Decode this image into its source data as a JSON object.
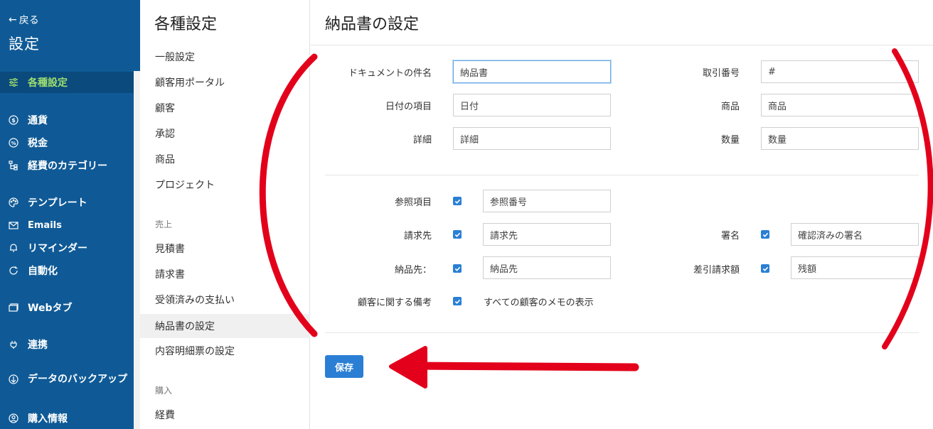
{
  "sidebar": {
    "back_label": "戻る",
    "title": "設定",
    "items": [
      {
        "label": "各種設定",
        "icon": "sliders-icon"
      },
      {
        "label": "通貨",
        "icon": "dollar-circle-icon"
      },
      {
        "label": "税金",
        "icon": "percent-circle-icon"
      },
      {
        "label": "経費のカテゴリー",
        "icon": "hierarchy-icon"
      },
      {
        "label": "テンプレート",
        "icon": "palette-icon"
      },
      {
        "label": "Emails",
        "icon": "mail-icon"
      },
      {
        "label": "リマインダー",
        "icon": "bell-icon"
      },
      {
        "label": "自動化",
        "icon": "refresh-icon"
      },
      {
        "label": "Webタブ",
        "icon": "tabs-icon"
      },
      {
        "label": "連携",
        "icon": "plug-icon"
      },
      {
        "label": "データのバックアップ",
        "icon": "backup-icon"
      },
      {
        "label": "購入情報",
        "icon": "user-circle-icon"
      }
    ]
  },
  "settings_list": {
    "title": "各種設定",
    "items_general": [
      "一般設定",
      "顧客用ポータル",
      "顧客",
      "承認",
      "商品",
      "プロジェクト"
    ],
    "group_sales": "売上",
    "items_sales": [
      "見積書",
      "請求書",
      "受領済みの支払い",
      "納品書の設定",
      "内容明細票の設定"
    ],
    "group_purchase": "購入",
    "items_purchase": [
      "経費"
    ]
  },
  "main": {
    "title": "納品書の設定",
    "fields": {
      "doc_subject": {
        "label": "ドキュメントの件名",
        "value": "納品書"
      },
      "date_field": {
        "label": "日付の項目",
        "value": "日付"
      },
      "details": {
        "label": "詳細",
        "value": "詳細"
      },
      "transaction_no": {
        "label": "取引番号",
        "value": "#"
      },
      "product": {
        "label": "商品",
        "value": "商品"
      },
      "quantity": {
        "label": "数量",
        "value": "数量"
      }
    },
    "options": {
      "reference": {
        "label": "参照項目",
        "value": "参照番号",
        "checked": true
      },
      "bill_to": {
        "label": "請求先",
        "value": "請求先",
        "checked": true
      },
      "ship_to": {
        "label": "納品先：",
        "value": "納品先",
        "checked": true
      },
      "customer_notes": {
        "label": "顧客に関する備考",
        "text": "すべての顧客のメモの表示",
        "checked": true
      },
      "signature": {
        "label": "署名",
        "value": "確認済みの署名",
        "checked": true
      },
      "balance": {
        "label": "差引請求額",
        "value": "残額",
        "checked": true
      }
    },
    "save_label": "保存"
  },
  "colors": {
    "sidebar_bg": "#0f5a96",
    "active_text": "#9fe06f",
    "primary": "#2a7fd4",
    "annotation": "#e3001b"
  }
}
